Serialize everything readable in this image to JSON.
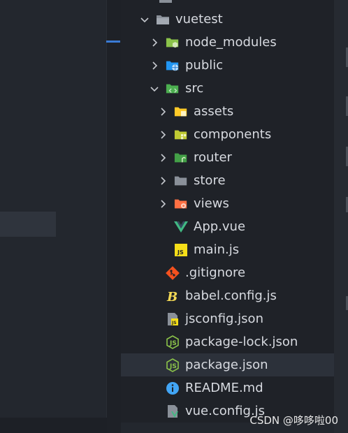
{
  "explorer": {
    "root_label": "vuetest",
    "items": [
      {
        "label": "node_modules"
      },
      {
        "label": "public"
      },
      {
        "label": "src"
      },
      {
        "label": "assets"
      },
      {
        "label": "components"
      },
      {
        "label": "router"
      },
      {
        "label": "store"
      },
      {
        "label": "views"
      },
      {
        "label": "App.vue"
      },
      {
        "label": "main.js"
      },
      {
        "label": ".gitignore"
      },
      {
        "label": "babel.config.js"
      },
      {
        "label": "jsconfig.json"
      },
      {
        "label": "package-lock.json"
      },
      {
        "label": "package.json"
      },
      {
        "label": "README.md"
      },
      {
        "label": "vue.config.js"
      }
    ],
    "selected_item": "package.json"
  },
  "watermark": "CSDN @哆哆啦00",
  "colors": {
    "folder": "#8a9099",
    "node_folder": "#8bc34a",
    "public_folder": "#2196f3",
    "src_folder": "#4caf50",
    "assets_folder": "#ffca28",
    "components_folder": "#c0ca33",
    "router_folder": "#43a047",
    "views_folder": "#ff7043",
    "vue": "#41b883",
    "js": "#f5de19",
    "git": "#f4511e",
    "babel": "#f5da55",
    "node_json": "#8bc34a",
    "info": "#42a5f5"
  }
}
